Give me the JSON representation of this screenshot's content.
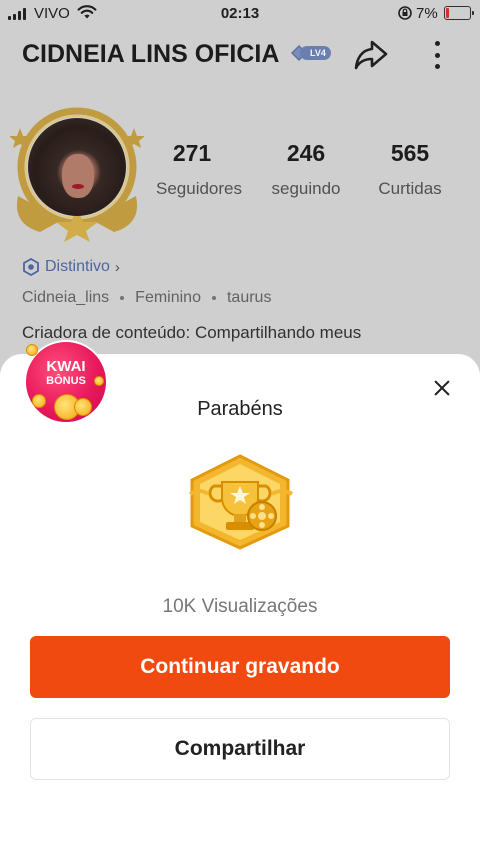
{
  "status_bar": {
    "carrier": "VIVO",
    "time": "02:13",
    "battery": "7%"
  },
  "profile": {
    "name": "CIDNEIA LINS OFICIA",
    "level_badge": "LV4",
    "stats": [
      {
        "value": "271",
        "label": "Seguidores"
      },
      {
        "value": "246",
        "label": "seguindo"
      },
      {
        "value": "565",
        "label": "Curtidas"
      }
    ],
    "badge_link": "Distintivo",
    "username": "Cidneia_lins",
    "gender": "Feminino",
    "sign": "taurus",
    "bio": "Criadora de conteúdo: Compartilhando meus"
  },
  "kwai_bonus": {
    "line1": "KWAI",
    "line2": "BÔNUS"
  },
  "sheet": {
    "title": "Parabéns",
    "achievement": "10K Visualizações",
    "primary_button": "Continuar gravando",
    "secondary_button": "Compartilhar"
  },
  "colors": {
    "accent": "#f04a10",
    "badge_blue": "#4f6ba8",
    "kwai_pink": "#e8185c",
    "gold": "#f2b52a"
  }
}
